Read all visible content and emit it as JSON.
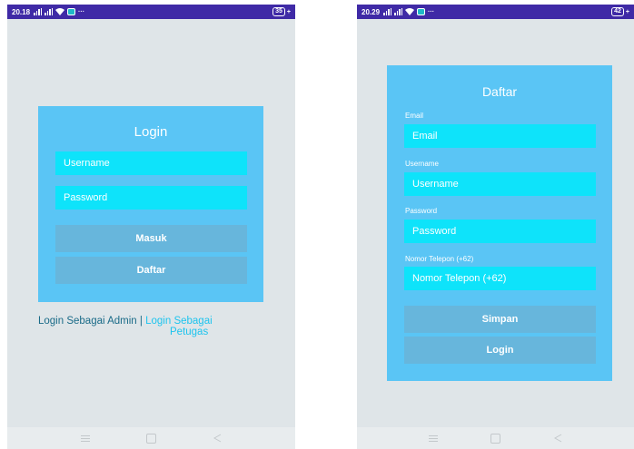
{
  "left_screen": {
    "status": {
      "time": "20.18",
      "battery": "35"
    },
    "login": {
      "title": "Login",
      "username_placeholder": "Username",
      "password_placeholder": "Password",
      "masuk_button": "Masuk",
      "daftar_button": "Daftar"
    },
    "links": {
      "admin": "Login Sebagai Admin",
      "separator": "|",
      "petugas_line1": "Login Sebagai",
      "petugas_line2": "Petugas"
    }
  },
  "right_screen": {
    "status": {
      "time": "20.29",
      "battery": "42"
    },
    "daftar": {
      "title": "Daftar",
      "email_label": "Email",
      "email_placeholder": "Email",
      "username_label": "Username",
      "username_placeholder": "Username",
      "password_label": "Password",
      "password_placeholder": "Password",
      "phone_label": "Nomor Telepon (+62)",
      "phone_placeholder": "Nomor Telepon (+62)",
      "simpan_button": "Simpan",
      "login_button": "Login"
    }
  },
  "colors": {
    "statusbar": "#3f2aa6",
    "background": "#dfe5e8",
    "card": "#5ac5f5",
    "field": "#0ee3fa",
    "button": "#67b6dc",
    "link_admin": "#1a6b88",
    "link_petugas": "#1dc4ee"
  },
  "icons": {
    "status": [
      "signal-icon",
      "wifi-icon",
      "notification-icon",
      "battery-icon"
    ],
    "nav": [
      "menu-icon",
      "home-icon",
      "back-icon"
    ]
  }
}
